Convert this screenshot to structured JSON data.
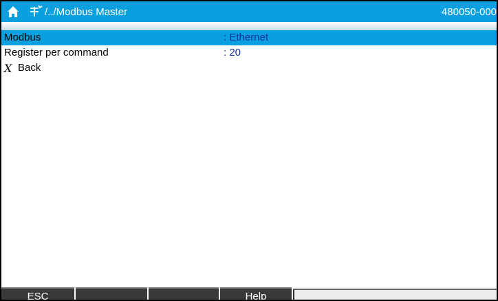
{
  "header": {
    "path": "/../Modbus Master",
    "device_id": "480050-000",
    "icons": {
      "home": "home-icon",
      "menu": "menu-tree-icon"
    }
  },
  "rows": [
    {
      "label": "Modbus",
      "value": ": Ethernet",
      "selected": true
    },
    {
      "label": "Register per command",
      "value": ": 20",
      "selected": false
    }
  ],
  "back": {
    "icon": "X",
    "label": "Back"
  },
  "softkeys": {
    "esc": "ESC",
    "key2": "",
    "key3": "",
    "help": "Help"
  },
  "colors": {
    "accent": "#0a9fde",
    "value_text": "#0f2f9f",
    "softkey_bg": "#3a3a3a"
  }
}
